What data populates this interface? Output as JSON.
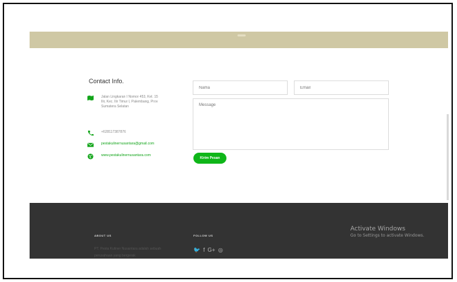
{
  "contact": {
    "title": "Contact Info.",
    "address": "Jalan Lingkaran I Nomor 453, Kel. 15 Ilir, Kec. Ilir Timur I, Palembang, Prov Sumatera Selatan",
    "phone": "+628117387876",
    "email": "pestakulinernusantara@gmail.com",
    "website": "www.pestakulinernusantara.com"
  },
  "form": {
    "name_placeholder": "Nama",
    "email_placeholder": "Email",
    "message_placeholder": "Message",
    "submit_label": "Kirim Pesan"
  },
  "footer": {
    "about_heading": "ABOUT US",
    "about_text": "PT. Pesta Kuliner Nusantara adalah sebuah perusahaan yang bergerak",
    "follow_heading": "FOLLOW US",
    "social_icons": [
      "twitter-icon",
      "facebook-icon",
      "google-plus-icon",
      "instagram-icon"
    ]
  },
  "os_overlay": {
    "title": "Activate Windows",
    "subtitle": "Go to Settings to activate Windows."
  },
  "colors": {
    "banner": "#cfc8a4",
    "accent_green": "#0fb619",
    "footer_bg": "#333333"
  }
}
